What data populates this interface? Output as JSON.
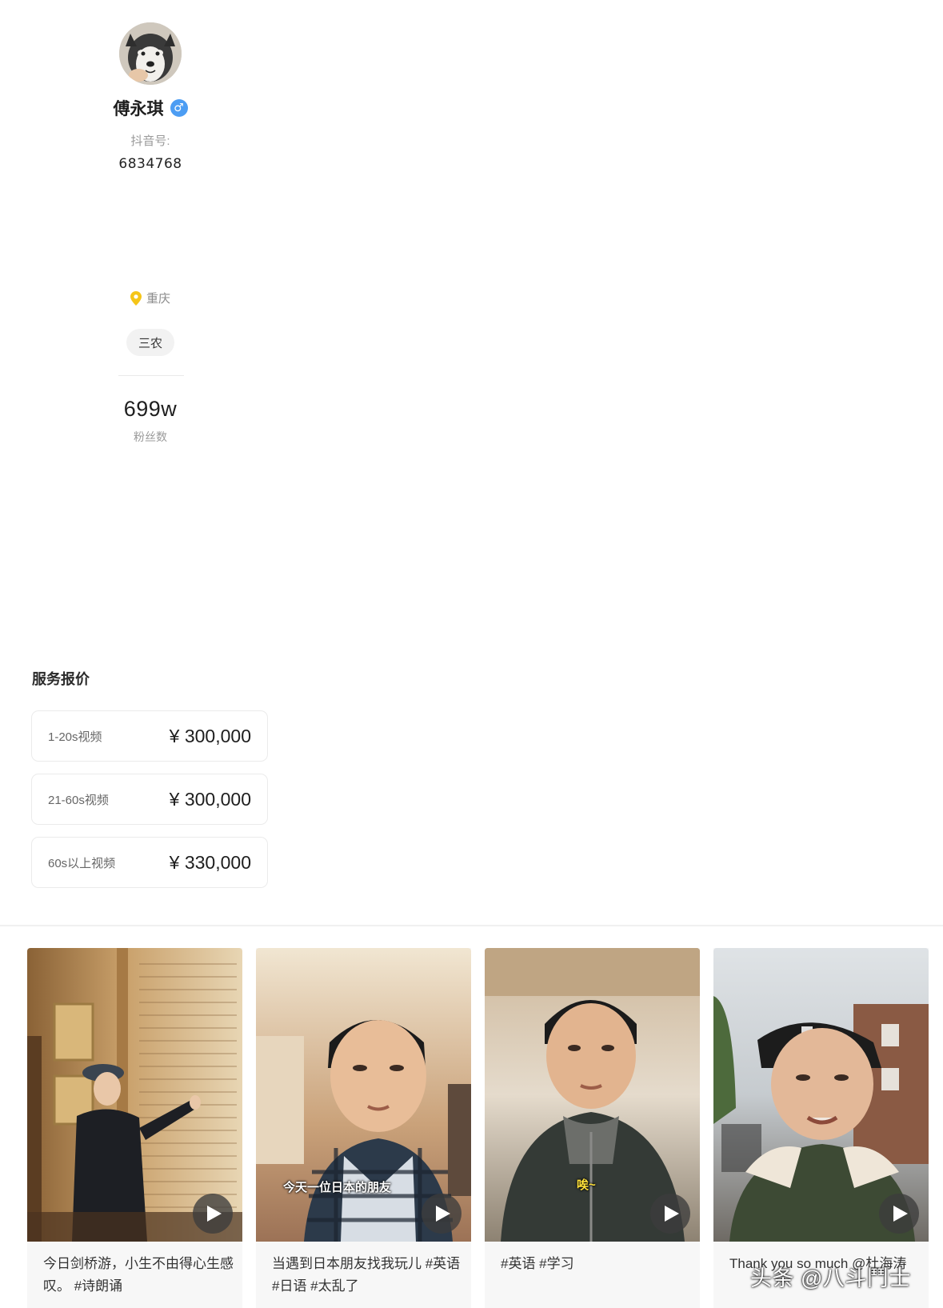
{
  "profile": {
    "name": "傅永琪",
    "gender_icon": "male-icon",
    "account_label": "抖音号:",
    "account_value": "6834768",
    "location_icon": "location-pin-icon",
    "location": "重庆",
    "tag": "三农",
    "fans_value": "699w",
    "fans_label": "粉丝数"
  },
  "pricing": {
    "title": "服务报价",
    "items": [
      {
        "label": "1-20s视频",
        "price": "¥ 300,000"
      },
      {
        "label": "21-60s视频",
        "price": "¥ 300,000"
      },
      {
        "label": "60s以上视频",
        "price": "¥ 330,000"
      }
    ]
  },
  "videos": [
    {
      "caption": "今日剑桥游，小生不由得心生感叹。 #诗朗诵",
      "overlay": ""
    },
    {
      "caption": "当遇到日本朋友找我玩儿 #英语 #日语 #太乱了",
      "overlay": "今天一位日本的朋友"
    },
    {
      "caption": "#英语 #学习",
      "overlay": "唉~"
    },
    {
      "caption": "Thank you so much @杜海涛",
      "overlay": ""
    }
  ],
  "watermark": "头条 @八斗鬥士",
  "colors": {
    "accent_blue": "#4c9df3",
    "pin_yellow": "#f5c518"
  }
}
